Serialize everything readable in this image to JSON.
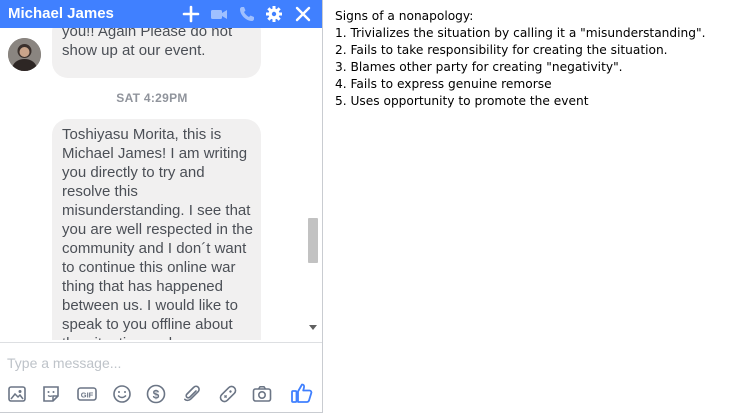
{
  "header": {
    "title": "Michael James",
    "icons": [
      "plus-icon",
      "video-icon",
      "phone-icon",
      "gear-icon",
      "close-icon"
    ],
    "color": "#4080ff"
  },
  "messages": {
    "partial_message": "you!! Again Please do not show up at our event.",
    "timestamp": "SAT 4:29PM",
    "main_message": "Toshiyasu Morita, this is Michael James! I am writing you directly to try and resolve this misunderstanding. I see that you are well respected in the community and I don´t want to continue this online war thing that has happened between us. I would like to speak to you offline about the situation and"
  },
  "composer": {
    "placeholder": "Type a message...",
    "tools": [
      "image-icon",
      "sticker-icon",
      "gif-icon",
      "emoji-icon",
      "dollar-icon",
      "attach-icon",
      "game-icon",
      "camera-icon",
      "thumbs-up-icon"
    ],
    "like_color": "#4080ff"
  },
  "notes": {
    "title": "Signs of a nonapology:",
    "items": [
      "1. Trivializes the situation by calling it a \"misunderstanding\".",
      "2. Fails to take responsibility for creating the situation.",
      "3. Blames other party for creating \"negativity\".",
      "4. Fails to express genuine remorse",
      "5. Uses opportunity to promote the event"
    ]
  }
}
